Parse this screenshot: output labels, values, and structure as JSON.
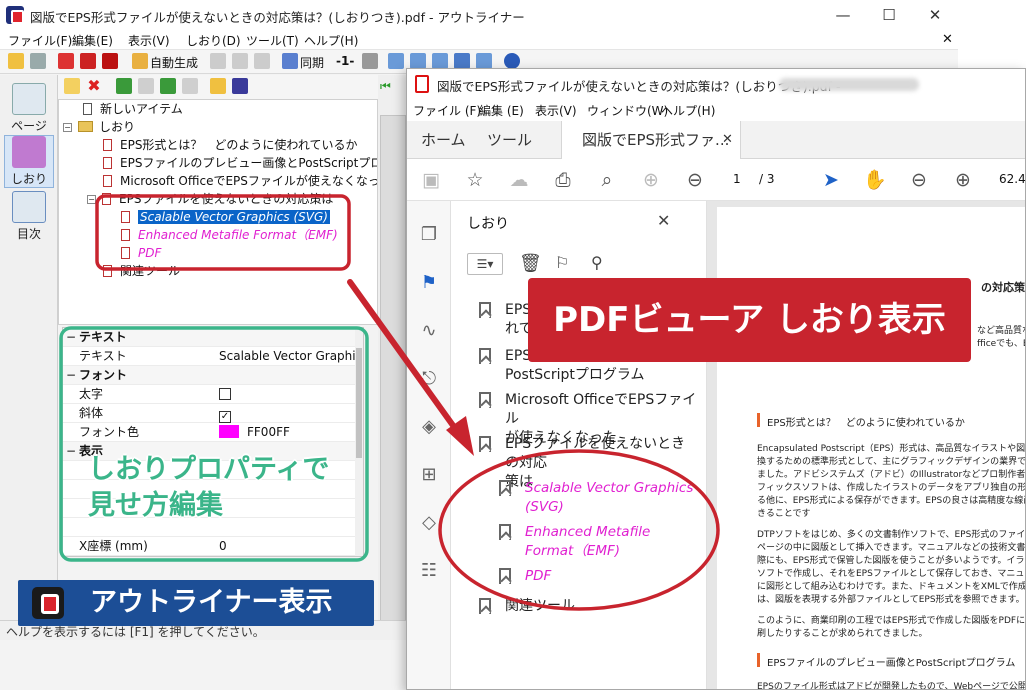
{
  "outliner": {
    "title": "図版でEPS形式ファイルが使えないときの対応策は？(しおりつき).pdf - アウトライナー",
    "window_controls": {
      "minimize": "—",
      "maximize": "☐",
      "close": "✕",
      "doc_close": "✕"
    },
    "menu": [
      "ファイル(F)",
      "編集(E)",
      "表示(V)",
      "しおり(D)",
      "ツール(T)",
      "ヘルプ(H)"
    ],
    "toolbar": {
      "auto_generate": "自動生成",
      "sync": "同期",
      "level": "-1-"
    },
    "side_buttons": [
      {
        "label": "ページ"
      },
      {
        "label": "しおり"
      },
      {
        "label": "目次"
      }
    ],
    "tree": [
      {
        "text": "新しいアイテム"
      },
      {
        "text": "しおり"
      },
      {
        "text": "EPS形式とは？　どのように使われているか"
      },
      {
        "text": "EPSファイルのプレビュー画像とPostScriptプログラム"
      },
      {
        "text": "Microsoft OfficeでEPSファイルが使えなくなった"
      },
      {
        "text": "EPSファイルを使えないときの対応策は"
      },
      {
        "text": "Scalable Vector Graphics (SVG)"
      },
      {
        "text": "Enhanced Metafile Format（EMF)"
      },
      {
        "text": "PDF"
      },
      {
        "text": "関連ツール"
      }
    ],
    "properties": {
      "category_text": "テキスト",
      "text_key": "テキスト",
      "text_value": "Scalable Vector Graphics",
      "category_font": "フォント",
      "bold_key": "太字",
      "bold_value": "false",
      "italic_key": "斜体",
      "italic_value": "true",
      "color_key": "フォント色",
      "color_value": "FF00FF",
      "color_hex": "#ff00ff",
      "category_display": "表示",
      "x_key": "X座標 (mm)",
      "x_value": "0"
    },
    "statusbar": "ヘルプを表示するには [F1] を押してください。"
  },
  "pdf_viewer": {
    "title": "図版でEPS形式ファイルが使えないときの対応策は？(しおりつき).pdf -",
    "menu": [
      "ファイル (F)",
      "編集 (E)",
      "表示(V)",
      "ウィンドウ(W)",
      "ヘルプ(H)"
    ],
    "tabs": {
      "home": "ホーム",
      "tools": "ツール",
      "doc": "図版でEPS形式ファ...",
      "close": "✕"
    },
    "page": {
      "current": "1",
      "total": "/ 3",
      "zoom": "62.4%"
    },
    "bookmarks_title": "しおり",
    "bookmarks_close": "✕",
    "bookmarks": [
      {
        "text": "EPS\nれて"
      },
      {
        "text": "EPS\nPostScriptプログラム"
      },
      {
        "text": "Microsoft OfficeでEPSファイル\nが使えなくなった"
      },
      {
        "text": "EPSファイルを使えないときの対応\n策は"
      },
      {
        "text": "Scalable Vector Graphics\n(SVG)"
      },
      {
        "text": "Enhanced Metafile\nFormat（EMF)"
      },
      {
        "text": "PDF"
      },
      {
        "text": "関連ツール"
      }
    ],
    "document": {
      "heading_fragment": "の対応策は",
      "section1": "EPS形式とは？　どのように使われているか",
      "section2": "EPSファイルのプレビュー画像とPostScriptプログラム",
      "lines1": [
        "Encapsulated Postscript（EPS）形式は、高品質なイラストや図版を保",
        "換するための標準形式として、主にグラフィックデザインの業界で使わ",
        "ました。アドビシステムズ（アドビ）のIllustratorなどプロ制作者向け",
        "フィックスソフトは、作成したイラストのデータをアプリ独自の形式で",
        "る他に、EPS形式による保存ができます。EPSの良さは高精度な線画を",
        "きることです"
      ],
      "lines2": [
        "DTPソフトをはじめ、多くの文書制作ソフトで、EPS形式のファイルを",
        "ページの中に図版として挿入できます。マニュアルなどの技術文書を作",
        "際にも、EPS形式で保管した図版を使うことが多いようです。イラスト",
        "ソフトで作成し、それをEPSファイルとして保存しておき、マニュアル",
        "に図形として組み込むわけです。また、ドキュメントをXMLで作成し",
        "は、図版を表現する外部ファイルとしてEPS形式を参照できます。"
      ],
      "lines3": [
        "このように、商業印刷の工程ではEPS形式で作成した図版をPDFにした",
        "刷したりすることが求められてきました。"
      ],
      "right_fragments": [
        "など高品質な",
        "fficeでも、EF"
      ],
      "last_line": "EPSのファイル形式はアドビが開発したもので、Webページで公開され"
    }
  },
  "annotations": {
    "pdf_banner": "PDFビューア しおり表示",
    "property_note_line1": "しおりプロパティで",
    "property_note_line2": "見せ方編集",
    "outliner_banner": "アウトライナー表示"
  },
  "colors": {
    "accent_red": "#c8242e",
    "accent_green": "#3bb58a",
    "accent_blue": "#1c4e96",
    "bookmark_magenta": "#e020d0"
  }
}
